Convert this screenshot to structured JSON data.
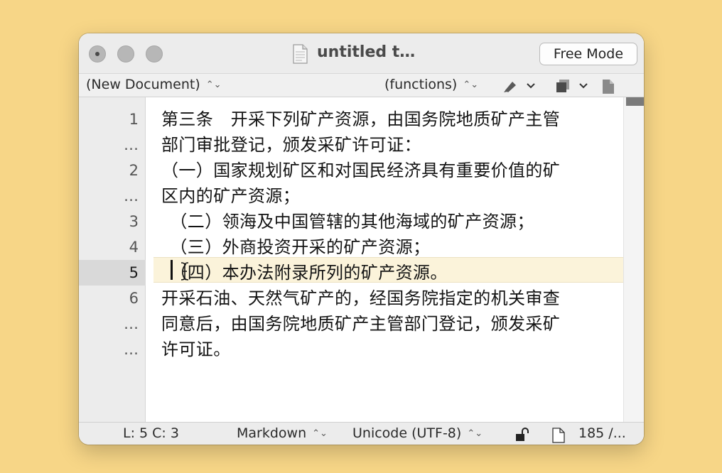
{
  "window": {
    "title": "untitled t…",
    "mode_button": "Free Mode"
  },
  "navbar": {
    "document_menu": "(New Document)",
    "functions_menu": "(functions)",
    "updown_glyph": "⌃⌄",
    "icons": [
      "marker-icon",
      "chevron-down-icon",
      "document-stack-icon",
      "chevron-down-icon",
      "page-icon"
    ]
  },
  "gutter": {
    "line_numbers": [
      "1",
      "…",
      "2",
      "…",
      "3",
      "4",
      "5",
      "6",
      "…",
      "…"
    ],
    "active_line": "5"
  },
  "editor": {
    "rows": [
      "第三条　开采下列矿产资源，由国务院地质矿产主管",
      "部门审批登记，颁发采矿许可证：",
      "（一）国家规划矿区和对国民经济具有重要价值的矿",
      "区内的矿产资源；",
      "　（二）领海及中国管辖的其他海域的矿产资源；",
      "　（三）外商投资开采的矿产资源；",
      "　（四）本办法附录所列的矿产资源。",
      "开采石油、天然气矿产的，经国务院指定的机关审查",
      "同意后，由国务院地质矿产主管部门登记，颁发采矿",
      "许可证。"
    ]
  },
  "statusbar": {
    "position": "L: 5 C: 3",
    "syntax": "Markdown",
    "encoding": "Unicode (UTF-8)",
    "count": "185 /..."
  },
  "colors": {
    "background": "#f7d687",
    "current_line_highlight": "#fbf3da"
  }
}
